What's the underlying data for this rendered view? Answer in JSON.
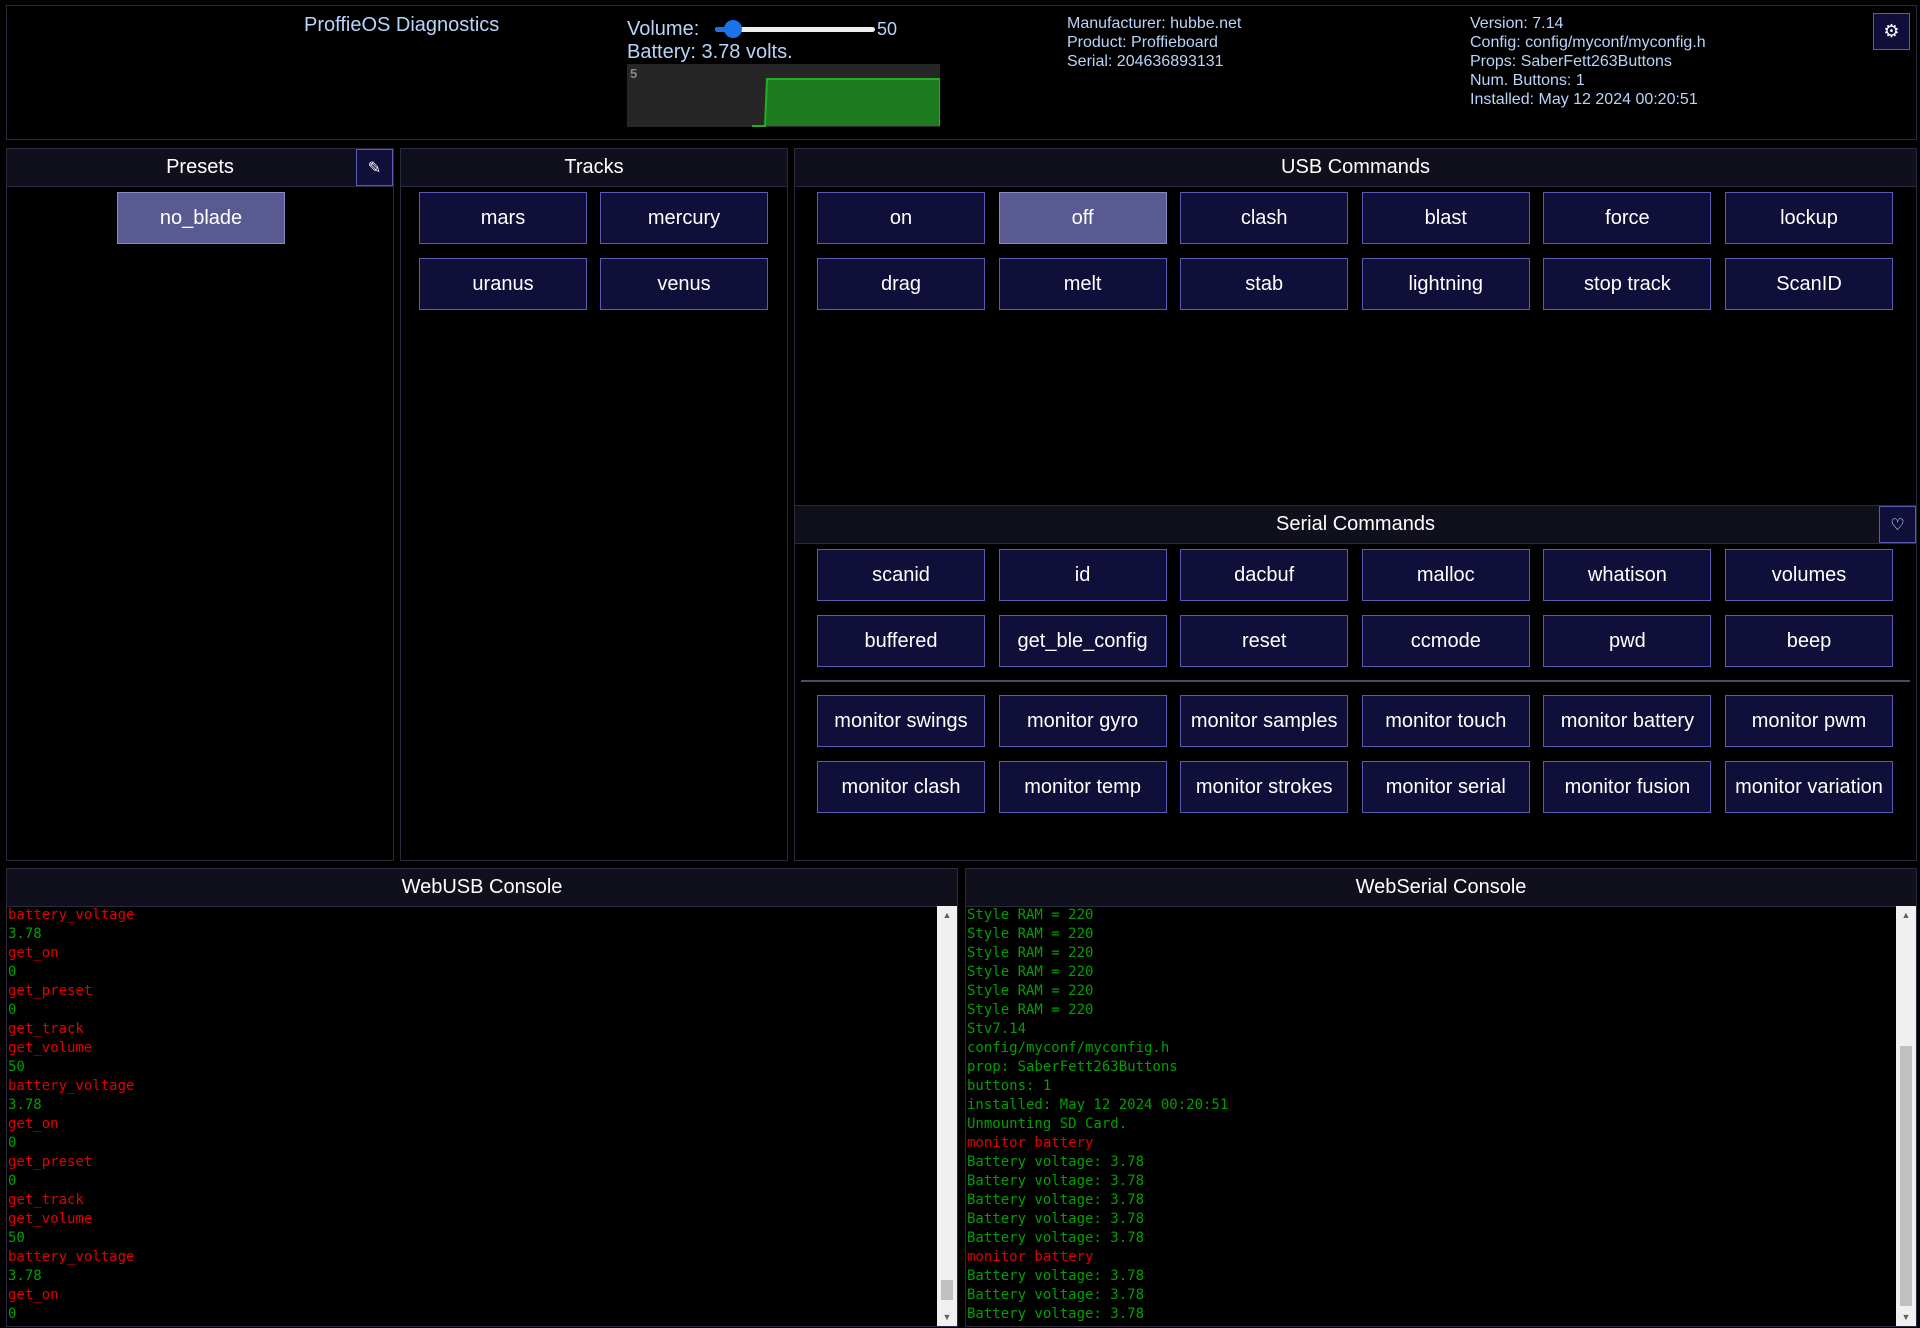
{
  "header": {
    "title": "ProffieOS Diagnostics",
    "volume_label": "Volume:",
    "volume_value": "50",
    "volume_fraction": 0.06,
    "battery_text": "Battery: 3.78 volts.",
    "battery_graph_label": "5",
    "manufacturer": "Manufacturer: hubbe.net",
    "product": "Product: Proffieboard",
    "serial": "Serial: 204636893131",
    "version": "Version: 7.14",
    "config": "Config: config/myconf/myconfig.h",
    "props": "Props: SaberFett263Buttons",
    "num_buttons": "Num. Buttons: 1",
    "installed": "Installed: May 12 2024 00:20:51",
    "settings_icon": "gear-icon"
  },
  "presets": {
    "title": "Presets",
    "edit_icon": "pencil-icon",
    "items": [
      "no_blade"
    ],
    "active_index": 0
  },
  "tracks": {
    "title": "Tracks",
    "items": [
      "mars",
      "mercury",
      "uranus",
      "venus"
    ]
  },
  "usb_commands": {
    "title": "USB Commands",
    "items": [
      "on",
      "off",
      "clash",
      "blast",
      "force",
      "lockup",
      "drag",
      "melt",
      "stab",
      "lightning",
      "stop track",
      "ScanID"
    ],
    "active_index": 1
  },
  "serial_commands": {
    "title": "Serial Commands",
    "heart_icon": "heart-icon",
    "items": [
      "scanid",
      "id",
      "dacbuf",
      "malloc",
      "whatison",
      "volumes",
      "buffered",
      "get_ble_config",
      "reset",
      "ccmode",
      "pwd",
      "beep"
    ],
    "monitor_items": [
      "monitor swings",
      "monitor gyro",
      "monitor samples",
      "monitor touch",
      "monitor battery",
      "monitor pwm",
      "monitor clash",
      "monitor temp",
      "monitor strokes",
      "monitor serial",
      "monitor fusion",
      "monitor variation"
    ]
  },
  "webusb_console": {
    "title": "WebUSB Console",
    "lines": [
      {
        "text": "battery_voltage",
        "kind": "cmd"
      },
      {
        "text": "3.78",
        "kind": "resp"
      },
      {
        "text": "get_on",
        "kind": "cmd"
      },
      {
        "text": "0",
        "kind": "resp"
      },
      {
        "text": "get_preset",
        "kind": "cmd"
      },
      {
        "text": "0",
        "kind": "resp"
      },
      {
        "text": "get_track",
        "kind": "cmd"
      },
      {
        "text": "get_volume",
        "kind": "cmd"
      },
      {
        "text": "50",
        "kind": "resp"
      },
      {
        "text": "battery_voltage",
        "kind": "cmd"
      },
      {
        "text": "3.78",
        "kind": "resp"
      },
      {
        "text": "get_on",
        "kind": "cmd"
      },
      {
        "text": "0",
        "kind": "resp"
      },
      {
        "text": "get_preset",
        "kind": "cmd"
      },
      {
        "text": "0",
        "kind": "resp"
      },
      {
        "text": "get_track",
        "kind": "cmd"
      },
      {
        "text": "get_volume",
        "kind": "cmd"
      },
      {
        "text": "50",
        "kind": "resp"
      },
      {
        "text": "battery_voltage",
        "kind": "cmd"
      },
      {
        "text": "3.78",
        "kind": "resp"
      },
      {
        "text": "get_on",
        "kind": "cmd"
      },
      {
        "text": "0",
        "kind": "resp"
      }
    ]
  },
  "webserial_console": {
    "title": "WebSerial Console",
    "lines": [
      {
        "text": "Style RAM = 220",
        "kind": "resp"
      },
      {
        "text": "Style RAM = 220",
        "kind": "resp"
      },
      {
        "text": "Style RAM = 220",
        "kind": "resp"
      },
      {
        "text": "Style RAM = 220",
        "kind": "resp"
      },
      {
        "text": "Style RAM = 220",
        "kind": "resp"
      },
      {
        "text": "Style RAM = 220",
        "kind": "resp"
      },
      {
        "text": "Stv7.14",
        "kind": "resp"
      },
      {
        "text": "config/myconf/myconfig.h",
        "kind": "resp"
      },
      {
        "text": "prop: SaberFett263Buttons",
        "kind": "resp"
      },
      {
        "text": "buttons: 1",
        "kind": "resp"
      },
      {
        "text": "installed: May 12 2024 00:20:51",
        "kind": "resp"
      },
      {
        "text": "Unmounting SD Card.",
        "kind": "resp"
      },
      {
        "text": "monitor battery",
        "kind": "cmd"
      },
      {
        "text": "Battery voltage: 3.78",
        "kind": "resp"
      },
      {
        "text": "Battery voltage: 3.78",
        "kind": "resp"
      },
      {
        "text": "Battery voltage: 3.78",
        "kind": "resp"
      },
      {
        "text": "Battery voltage: 3.78",
        "kind": "resp"
      },
      {
        "text": "Battery voltage: 3.78",
        "kind": "resp"
      },
      {
        "text": "monitor battery",
        "kind": "cmd"
      },
      {
        "text": "Battery voltage: 3.78",
        "kind": "resp"
      },
      {
        "text": "Battery voltage: 3.78",
        "kind": "resp"
      },
      {
        "text": "Battery voltage: 3.78",
        "kind": "resp"
      }
    ]
  },
  "colors": {
    "button_bg": "#0f0f3a",
    "button_border": "#5a5ab0",
    "button_active": "#5a5a92",
    "command_text": "#e00000",
    "response_text": "#00a000",
    "battery_graph": "#1e7a1e"
  }
}
